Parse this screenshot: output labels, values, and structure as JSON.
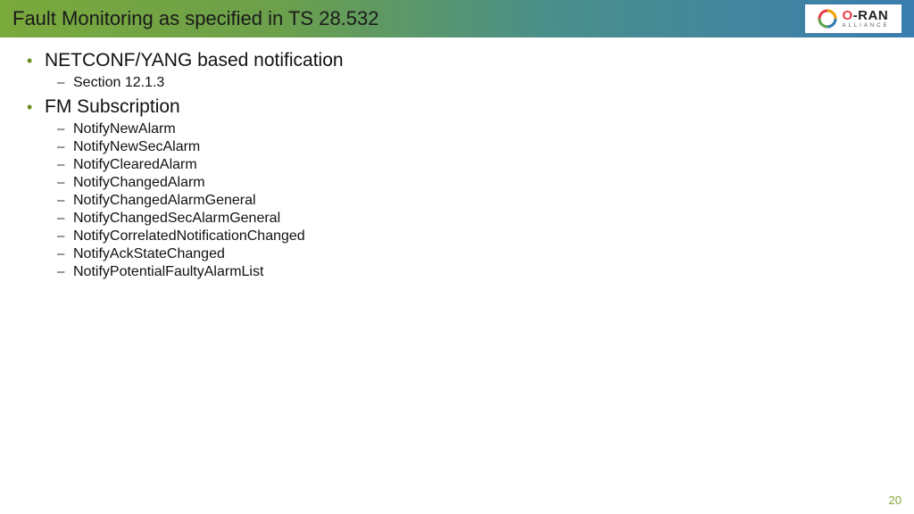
{
  "title": "Fault Monitoring as specified in TS 28.532",
  "logo": {
    "main": "-RAN",
    "sub": "ALLIANCE"
  },
  "bullets": [
    {
      "label": "NETCONF/YANG based notification",
      "sub": [
        "Section 12.1.3"
      ]
    },
    {
      "label": "FM Subscription",
      "sub": [
        "NotifyNewAlarm",
        "NotifyNewSecAlarm",
        "NotifyClearedAlarm",
        "NotifyChangedAlarm",
        "NotifyChangedAlarmGeneral",
        "NotifyChangedSecAlarmGeneral",
        "NotifyCorrelatedNotificationChanged",
        "NotifyAckStateChanged",
        "NotifyPotentialFaultyAlarmList"
      ]
    }
  ],
  "page_number": "20"
}
